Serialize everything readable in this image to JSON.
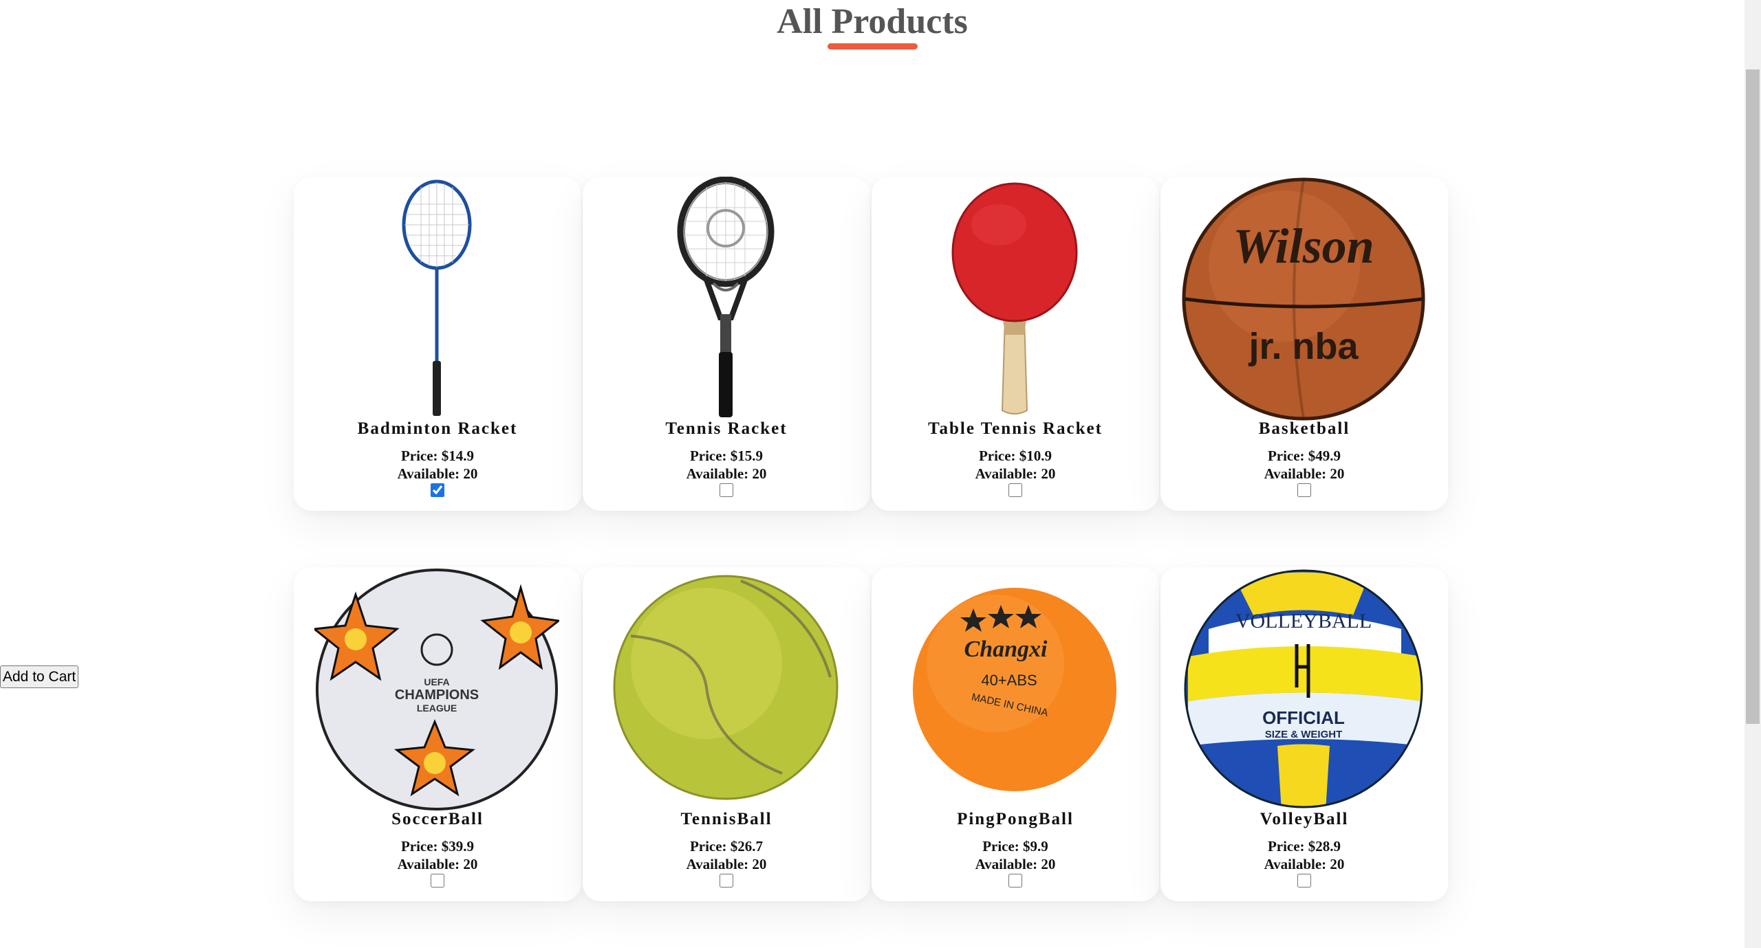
{
  "page": {
    "title": "All Products",
    "accent_color": "#f05a40"
  },
  "products": [
    {
      "name": "Badminton Racket",
      "price": "Price: $14.9",
      "available": "Available: 20",
      "checked": true,
      "image_icon": "badminton-racket-icon"
    },
    {
      "name": "Tennis Racket",
      "price": "Price: $15.9",
      "available": "Available: 20",
      "checked": false,
      "image_icon": "tennis-racket-icon"
    },
    {
      "name": "Table Tennis Racket",
      "price": "Price: $10.9",
      "available": "Available: 20",
      "checked": false,
      "image_icon": "table-tennis-paddle-icon"
    },
    {
      "name": "Basketball",
      "price": "Price: $49.9",
      "available": "Available: 20",
      "checked": false,
      "image_icon": "basketball-icon"
    },
    {
      "name": "SoccerBall",
      "price": "Price: $39.9",
      "available": "Available: 20",
      "checked": false,
      "image_icon": "soccer-ball-icon"
    },
    {
      "name": "TennisBall",
      "price": "Price: $26.7",
      "available": "Available: 20",
      "checked": false,
      "image_icon": "tennis-ball-icon"
    },
    {
      "name": "PingPongBall",
      "price": "Price: $9.9",
      "available": "Available: 20",
      "checked": false,
      "image_icon": "ping-pong-ball-icon"
    },
    {
      "name": "VolleyBall",
      "price": "Price: $28.9",
      "available": "Available: 20",
      "checked": false,
      "image_icon": "volleyball-icon"
    }
  ],
  "image_text": {
    "basketball_brand": "Wilson",
    "basketball_sub": "jr. nba",
    "soccer_top": "UEFA",
    "soccer_mid": "CHAMPIONS",
    "soccer_bot": "LEAGUE",
    "pingpong_brand": "Changxi",
    "pingpong_spec": "40+ABS",
    "pingpong_origin": "MADE IN CHINA",
    "volley_brand": "VOLLEYBALL",
    "volley_official": "OFFICIAL",
    "volley_size": "SIZE & WEIGHT"
  },
  "actions": {
    "add_to_cart": "Add to Cart"
  }
}
